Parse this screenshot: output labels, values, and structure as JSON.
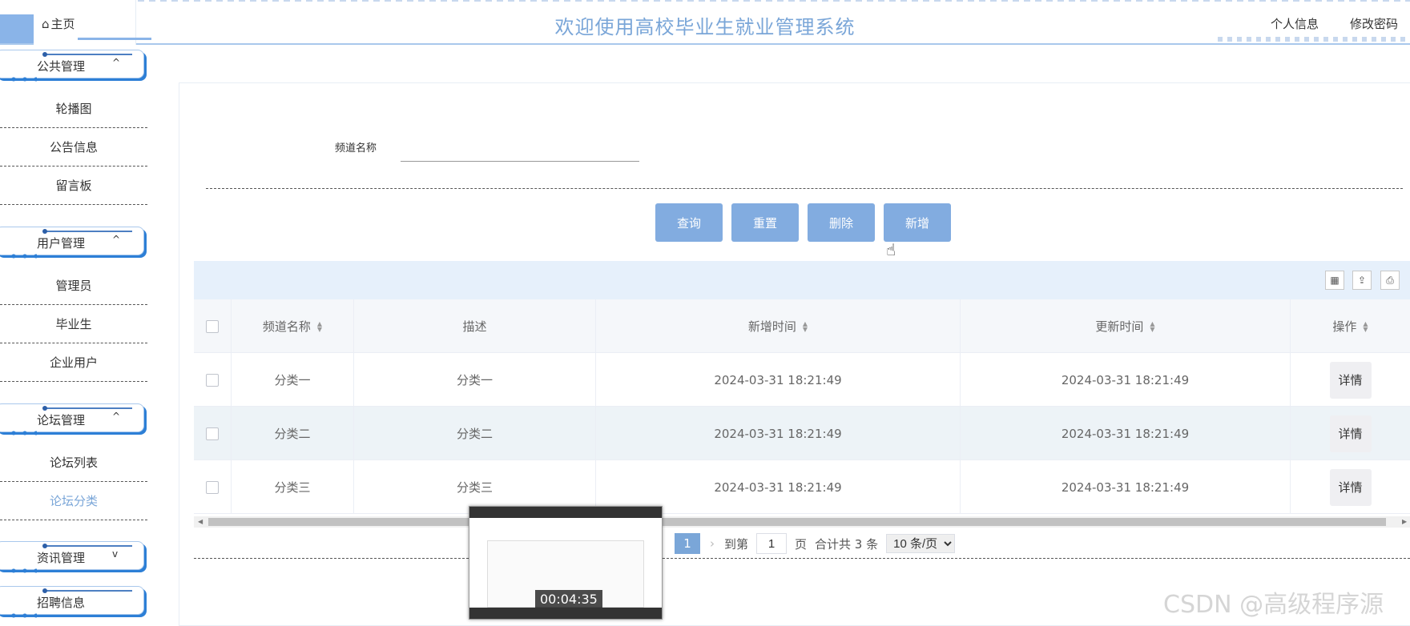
{
  "header": {
    "home_tab": "主页",
    "title": "欢迎使用高校毕业生就业管理系统",
    "profile_link": "个人信息",
    "password_link": "修改密码"
  },
  "sidebar": {
    "groups": [
      {
        "label": "公共管理",
        "chevron": "^",
        "items": [
          "轮播图",
          "公告信息",
          "留言板"
        ]
      },
      {
        "label": "用户管理",
        "chevron": "^",
        "items": [
          "管理员",
          "毕业生",
          "企业用户"
        ]
      },
      {
        "label": "论坛管理",
        "chevron": "^",
        "items": [
          "论坛列表",
          "论坛分类"
        ]
      },
      {
        "label": "资讯管理",
        "chevron": "v",
        "items": []
      },
      {
        "label": "招聘信息",
        "chevron": "",
        "items": []
      }
    ],
    "active_item": "论坛分类"
  },
  "search": {
    "label": "频道名称",
    "value": ""
  },
  "buttons": {
    "query": "查询",
    "reset": "重置",
    "delete": "删除",
    "add": "新增"
  },
  "table": {
    "columns": [
      "频道名称",
      "描述",
      "新增时间",
      "更新时间",
      "操作"
    ],
    "rows": [
      {
        "name": "分类一",
        "desc": "分类一",
        "created": "2024-03-31 18:21:49",
        "updated": "2024-03-31 18:21:49",
        "action": "详情"
      },
      {
        "name": "分类二",
        "desc": "分类二",
        "created": "2024-03-31 18:21:49",
        "updated": "2024-03-31 18:21:49",
        "action": "详情"
      },
      {
        "name": "分类三",
        "desc": "分类三",
        "created": "2024-03-31 18:21:49",
        "updated": "2024-03-31 18:21:49",
        "action": "详情"
      }
    ]
  },
  "pagination": {
    "current_page": "1",
    "goto_label": "到第",
    "goto_value": "1",
    "page_unit": "页",
    "total": "合计共 3 条",
    "page_size": "10 条/页"
  },
  "video": {
    "timestamp": "00:04:35"
  },
  "watermark": "CSDN @高级程序源",
  "colors": {
    "accent": "#7aa6d8",
    "button": "#82ace0",
    "toolbar_bg": "#e6f0fb"
  }
}
